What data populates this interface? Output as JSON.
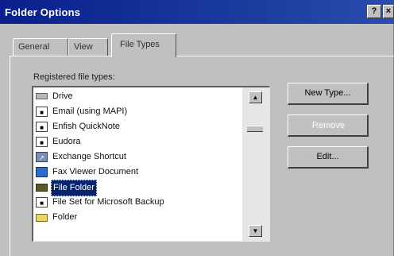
{
  "window": {
    "title": "Folder Options",
    "help_glyph": "?",
    "close_glyph": "×"
  },
  "tabs": [
    {
      "label": "General"
    },
    {
      "label": "View"
    },
    {
      "label": "File Types",
      "active": true
    }
  ],
  "registered": {
    "label": "Registered file types:",
    "items": [
      {
        "label": "Drive",
        "icon": "drive-icon"
      },
      {
        "label": "Email (using MAPI)",
        "icon": "document-icon"
      },
      {
        "label": "Enfish QuickNote",
        "icon": "document-icon"
      },
      {
        "label": "Eudora",
        "icon": "document-icon"
      },
      {
        "label": "Exchange Shortcut",
        "icon": "shortcut-icon"
      },
      {
        "label": "Fax Viewer Document",
        "icon": "fax-document-icon"
      },
      {
        "label": "File Folder",
        "icon": "folder-icon",
        "selected": true
      },
      {
        "label": "File Set for Microsoft Backup",
        "icon": "document-icon"
      },
      {
        "label": "Folder",
        "icon": "folder-icon"
      }
    ]
  },
  "scroll": {
    "up_glyph": "▲",
    "down_glyph": "▼"
  },
  "buttons": {
    "new_type": "New Type...",
    "remove": "Remove",
    "edit": "Edit..."
  },
  "colors": {
    "titlebar": "#0a246a",
    "selection": "#0a246a",
    "face": "#c0c0c0"
  }
}
